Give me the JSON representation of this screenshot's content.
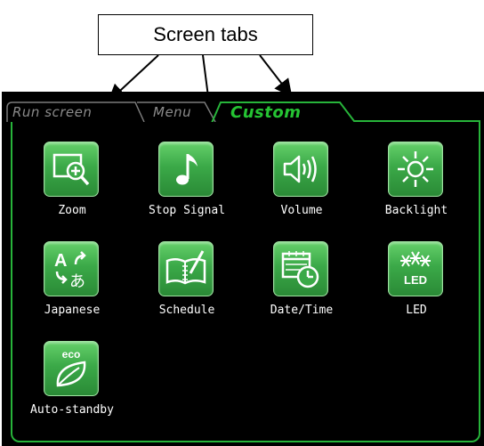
{
  "callout": {
    "label": "Screen tabs"
  },
  "tabs": [
    {
      "label": "Run screen",
      "active": false
    },
    {
      "label": "Menu",
      "active": false
    },
    {
      "label": "Custom",
      "active": true
    }
  ],
  "colors": {
    "accent_green": "#25c433",
    "tile_green": "#3ba948",
    "tab_inactive": "#8a8a8a",
    "screen_bg": "#000000"
  },
  "tiles": [
    {
      "label": "Zoom",
      "icon": "zoom-icon"
    },
    {
      "label": "Stop Signal",
      "icon": "music-note-icon"
    },
    {
      "label": "Volume",
      "icon": "speaker-icon"
    },
    {
      "label": "Backlight",
      "icon": "sun-icon"
    },
    {
      "label": "Japanese",
      "icon": "language-icon",
      "icon_text": [
        "A",
        "あ"
      ]
    },
    {
      "label": "Schedule",
      "icon": "notebook-pen-icon"
    },
    {
      "label": "Date/Time",
      "icon": "calendar-clock-icon"
    },
    {
      "label": "LED",
      "icon": "led-icon",
      "icon_text": "LED"
    },
    {
      "label": "Auto-standby",
      "icon": "eco-leaf-icon",
      "icon_text": "eco"
    }
  ]
}
